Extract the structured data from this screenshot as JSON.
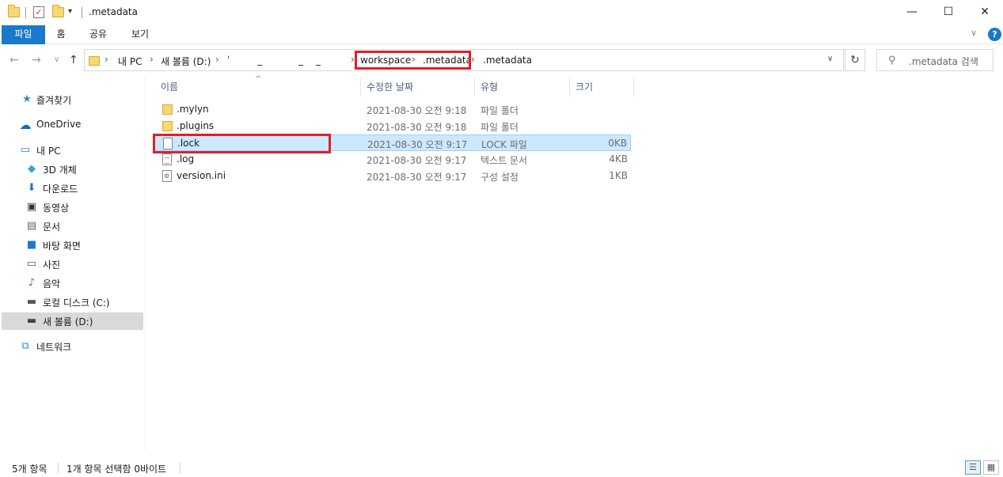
{
  "window": {
    "title": ".metadata",
    "minimize": "—",
    "maximize": "☐",
    "close": "✕"
  },
  "ribbon": {
    "tabs": [
      "파일",
      "홈",
      "공유",
      "보기"
    ],
    "expand_icon": "∨",
    "help": "?"
  },
  "nav": {
    "back": "←",
    "forward": "→",
    "recent": "∨",
    "up": "↑",
    "breadcrumb": [
      "내 PC",
      "새 볼륨 (D:)",
      "ˈ",
      "_",
      "_",
      "_",
      "workspace",
      ".metadata",
      ".metadata"
    ],
    "refresh": "↻",
    "search_placeholder": ".metadata 검색"
  },
  "sidebar": {
    "items": [
      {
        "label": "즐겨찾기",
        "icon": "star-icon"
      },
      {
        "label": "OneDrive",
        "icon": "cloud-icon"
      },
      {
        "label": "내 PC",
        "icon": "computer-icon"
      },
      {
        "label": "3D 개체",
        "icon": "cube-icon"
      },
      {
        "label": "다운로드",
        "icon": "download-icon"
      },
      {
        "label": "동영상",
        "icon": "video-icon"
      },
      {
        "label": "문서",
        "icon": "document-icon"
      },
      {
        "label": "바탕 화면",
        "icon": "desktop-icon"
      },
      {
        "label": "사진",
        "icon": "pictures-icon"
      },
      {
        "label": "음악",
        "icon": "music-icon"
      },
      {
        "label": "로컬 디스크 (C:)",
        "icon": "drive-icon"
      },
      {
        "label": "새 볼륨 (D:)",
        "icon": "drive-icon",
        "selected": true
      },
      {
        "label": "네트워크",
        "icon": "network-icon"
      }
    ]
  },
  "columns": {
    "name": "이름",
    "date": "수정한 날짜",
    "type": "유형",
    "size": "크기",
    "sort_caret": "^"
  },
  "files": [
    {
      "name": ".mylyn",
      "date": "2021-08-30 오전 9:18",
      "type": "파일 폴더",
      "size": "",
      "icon": "folder-icon"
    },
    {
      "name": ".plugins",
      "date": "2021-08-30 오전 9:18",
      "type": "파일 폴더",
      "size": "",
      "icon": "folder-icon"
    },
    {
      "name": ".lock",
      "date": "2021-08-30 오전 9:17",
      "type": "LOCK 파일",
      "size": "0KB",
      "icon": "file-icon",
      "selected": true
    },
    {
      "name": ".log",
      "date": "2021-08-30 오전 9:17",
      "type": "텍스트 문서",
      "size": "4KB",
      "icon": "text-file-icon"
    },
    {
      "name": "version.ini",
      "date": "2021-08-30 오전 9:17",
      "type": "구성 설정",
      "size": "1KB",
      "icon": "settings-file-icon"
    }
  ],
  "status": {
    "item_count": "5개 항목",
    "selection": "1개 항목 선택함 0바이트"
  },
  "colors": {
    "accent": "#1979ca",
    "selection_bg": "#cce8ff",
    "highlight": "#e0202b"
  }
}
